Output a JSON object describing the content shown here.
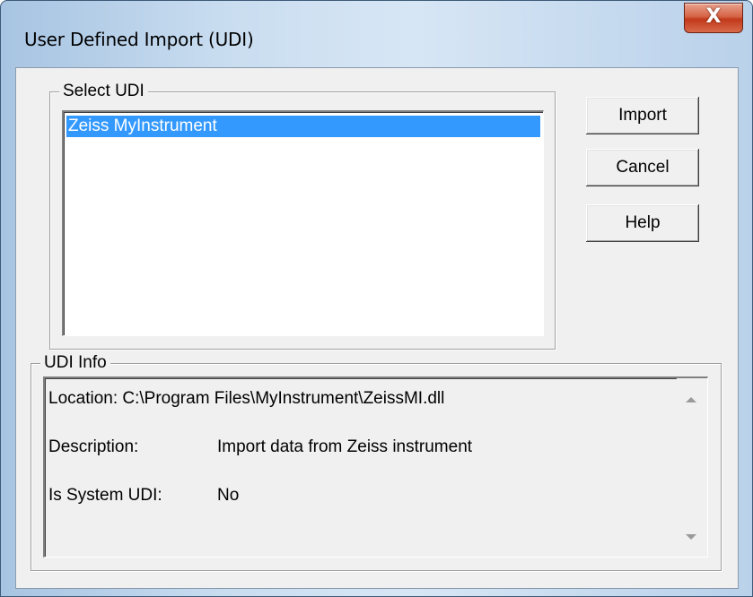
{
  "window": {
    "title": "User Defined Import (UDI)",
    "close_label": "X"
  },
  "select_group": {
    "label": "Select UDI",
    "items": [
      {
        "label": "Zeiss MyInstrument",
        "selected": true
      }
    ]
  },
  "buttons": {
    "import": "Import",
    "cancel": "Cancel",
    "help": "Help"
  },
  "info_group": {
    "label": "UDI Info",
    "location": "Location:  C:\\Program Files\\MyInstrument\\ZeissMI.dll",
    "description_label": "Description:",
    "description_value": "Import data from Zeiss instrument",
    "system_label": "Is System UDI:",
    "system_value": "No"
  },
  "icons": {
    "close": "close-icon",
    "scroll_up": "scroll-up-arrow-icon",
    "scroll_down": "scroll-down-arrow-icon"
  },
  "colors": {
    "selection": "#3399ff",
    "close_button": "#c7472a",
    "dialog_face": "#f0f0f0"
  }
}
